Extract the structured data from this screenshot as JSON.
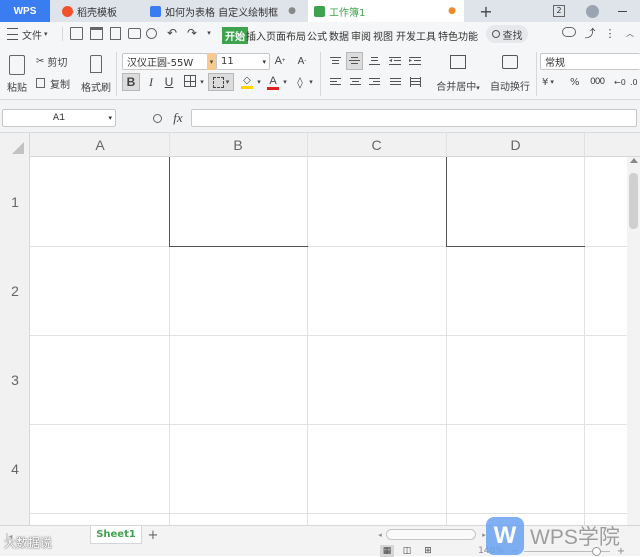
{
  "tabs": [
    {
      "label": "WPS"
    },
    {
      "label": "稻壳模板"
    },
    {
      "label": "如何为表格 自定义绘制框"
    },
    {
      "label": "工作簿1"
    }
  ],
  "window": {
    "badge": "2"
  },
  "menu": {
    "file": "文件",
    "items": [
      "开始",
      "插入",
      "页面布局",
      "公式",
      "数据",
      "审阅",
      "视图",
      "开发工具",
      "特色功能"
    ],
    "search": "查找"
  },
  "clipboard": {
    "paste": "粘贴",
    "cut": "剪切",
    "copy": "复制",
    "format_painter": "格式刷"
  },
  "font": {
    "name": "汉仪正圆-55W",
    "size": "11",
    "bold": "B",
    "italic": "I",
    "underline": "U"
  },
  "alignment": {
    "merge": "合并居中",
    "wrap": "自动换行"
  },
  "number": {
    "format": "常规",
    "currency": "¥",
    "percent": "%"
  },
  "formula_bar": {
    "cell_ref": "A1",
    "fx": "fx",
    "value": ""
  },
  "columns": [
    "A",
    "B",
    "C",
    "D"
  ],
  "rows": [
    "1",
    "2",
    "3",
    "4"
  ],
  "sheets": [
    {
      "name": "Sheet1"
    }
  ],
  "status": {
    "zoom": "140%"
  },
  "watermark": {
    "left": "大数据说",
    "right": "WPS学院",
    "logo_letter": "W"
  },
  "colors": {
    "accent_green": "#3fa34d",
    "wps_blue": "#2b6ee6",
    "brand_badge": "#6aa2f2"
  }
}
